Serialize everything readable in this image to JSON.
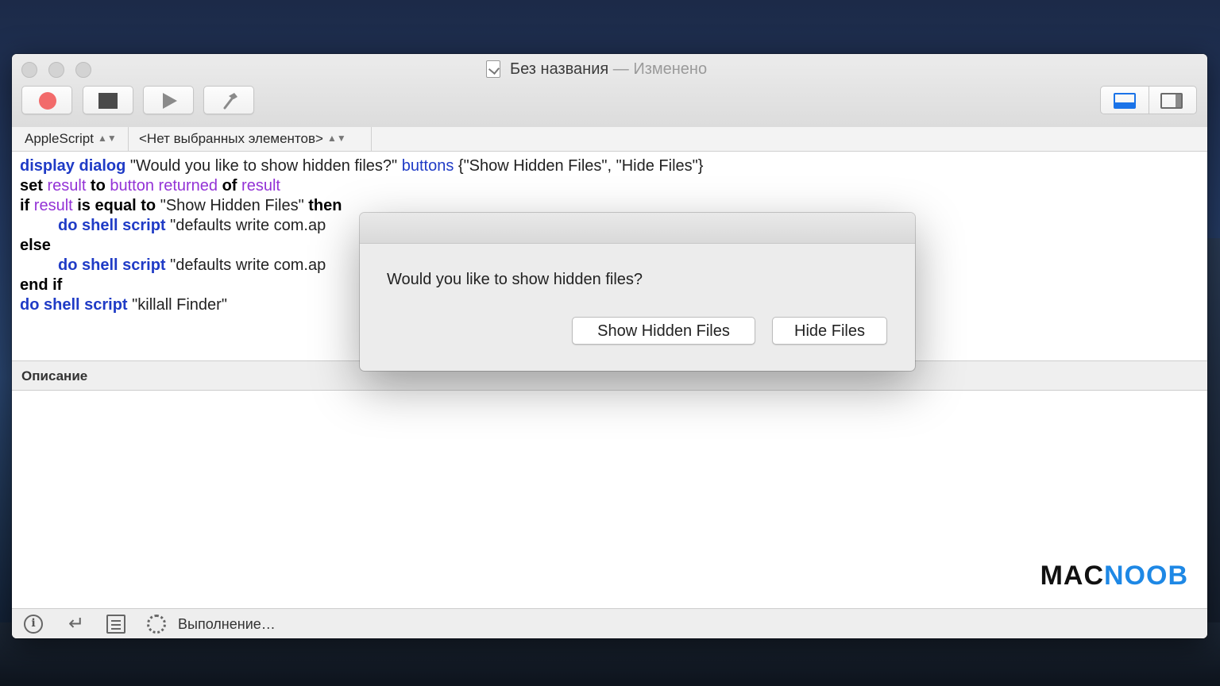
{
  "window": {
    "title": "Без названия",
    "title_separator": "—",
    "title_status": "Изменено"
  },
  "toolbar": {
    "record_icon": "record-icon",
    "stop_icon": "stop-icon",
    "run_icon": "play-icon",
    "compile_icon": "hammer-icon",
    "view_toggle_icons": [
      "bottom-pane-icon",
      "side-pane-icon"
    ]
  },
  "navbar": {
    "language": "AppleScript",
    "elements": "<Нет выбранных элементов>"
  },
  "code": {
    "l1_kw": "display dialog",
    "l1_str": " \"Would you like to show hidden files?\" ",
    "l1_param": "buttons",
    "l1_rest": " {\"Show Hidden Files\", \"Hide Files\"}",
    "l2_set": "set ",
    "l2_result": "result",
    "l2_to": " to ",
    "l2_button_returned": "button returned",
    "l2_of": " of ",
    "l2_result2": "result",
    "l3_if": "if ",
    "l3_result": "result",
    "l3_eq": " is equal to ",
    "l3_str": "\"Show Hidden Files\" ",
    "l3_then": "then",
    "l4_kw": "do shell script",
    "l4_str": " \"defaults write com.ap",
    "l5_else": "else",
    "l6_kw": "do shell script",
    "l6_str": " \"defaults write com.ap",
    "l7_endif": "end if",
    "l8_kw": "do shell script",
    "l8_str": " \"killall Finder\""
  },
  "description": {
    "label": "Описание"
  },
  "logo": {
    "part1": "MAC",
    "part2": "NOOB"
  },
  "statusbar": {
    "status": "Выполнение…",
    "icons": [
      "info-icon",
      "return-icon",
      "list-icon",
      "spinner-icon"
    ]
  },
  "dialog": {
    "message": "Would you like to show hidden files?",
    "buttons": [
      "Show Hidden Files",
      "Hide Files"
    ]
  }
}
